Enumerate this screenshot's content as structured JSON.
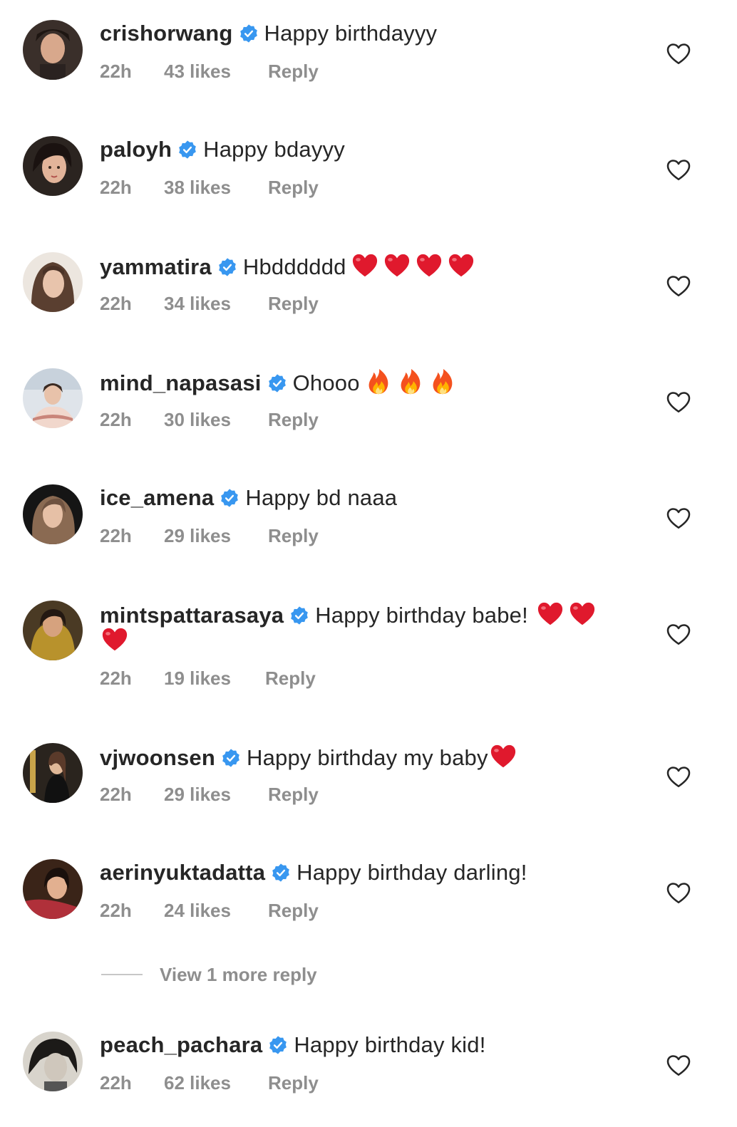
{
  "colors": {
    "text": "#262626",
    "secondary": "#8e8e8e",
    "verified": "#3897f0",
    "heart_emoji": "#e0192d"
  },
  "icons": {
    "verified": "verified-badge-icon",
    "like": "heart-outline-icon",
    "heart_emoji": "red-heart-emoji",
    "fire_emoji": "fire-emoji"
  },
  "comments": [
    {
      "username": "crishorwang",
      "text": "Happy birthdayyy",
      "emojis_before_wrap": [],
      "emojis_after_wrap": [],
      "time": "22h",
      "likes": "43 likes",
      "reply": "Reply"
    },
    {
      "username": "paloyh",
      "text": "Happy bdayyy",
      "emojis_before_wrap": [],
      "emojis_after_wrap": [],
      "time": "22h",
      "likes": "38 likes",
      "reply": "Reply"
    },
    {
      "username": "yammatira",
      "text": "Hbdddddd",
      "emojis_before_wrap": [
        "heart",
        "heart",
        "heart",
        "heart"
      ],
      "emojis_after_wrap": [],
      "time": "22h",
      "likes": "34 likes",
      "reply": "Reply"
    },
    {
      "username": "mind_napasasi",
      "text": "Ohooo",
      "emojis_before_wrap": [
        "fire",
        "fire",
        "fire"
      ],
      "emojis_after_wrap": [],
      "time": "22h",
      "likes": "30 likes",
      "reply": "Reply"
    },
    {
      "username": "ice_amena",
      "text": "Happy bd naaa",
      "emojis_before_wrap": [],
      "emojis_after_wrap": [],
      "time": "22h",
      "likes": "29 likes",
      "reply": "Reply"
    },
    {
      "username": "mintspattarasaya",
      "text": "Happy birthday babe!",
      "emojis_before_wrap": [
        "heart",
        "heart"
      ],
      "emojis_after_wrap": [
        "heart"
      ],
      "time": "22h",
      "likes": "19 likes",
      "reply": "Reply"
    },
    {
      "username": "vjwoonsen",
      "text": "Happy birthday my baby",
      "emojis_before_wrap": [
        "heart"
      ],
      "emojis_after_wrap": [],
      "time": "22h",
      "likes": "29 likes",
      "reply": "Reply"
    },
    {
      "username": "aerinyuktadatta",
      "text": "Happy birthday darling!",
      "emojis_before_wrap": [],
      "emojis_after_wrap": [],
      "time": "22h",
      "likes": "24 likes",
      "reply": "Reply"
    },
    {
      "username": "peach_pachara",
      "text": "Happy birthday kid!",
      "emojis_before_wrap": [],
      "emojis_after_wrap": [],
      "time": "22h",
      "likes": "62 likes",
      "reply": "Reply"
    }
  ],
  "view_more_replies": "View 1 more reply"
}
